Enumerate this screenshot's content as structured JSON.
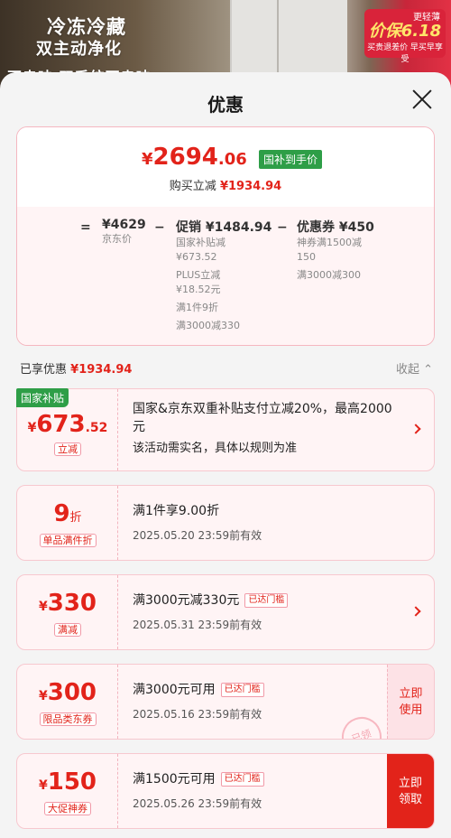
{
  "background": {
    "line1": "冷冻冷藏",
    "line2": "双主动净化",
    "line3": "不串味 双系统不串味",
    "promo_top": "更轻薄",
    "promo_main": "价保6.18",
    "promo_sub": "买贵退差价 早买早享受"
  },
  "sheet": {
    "title": "优惠"
  },
  "summary": {
    "price_yen": "¥",
    "price_int": "2694",
    "price_dec": ".06",
    "price_tag": "国补到手价",
    "save_label": "购买立减",
    "save_amount": "¥1934.94",
    "equals": "=",
    "jd_price": "¥4629",
    "jd_price_label": "京东价",
    "minus": "−",
    "promo_title": "促销",
    "promo_amount": "¥1484.94",
    "promo_lines": [
      "国家补贴减",
      "¥673.52",
      "PLUS立减",
      "¥18.52元",
      "满1件9折",
      "满3000减330"
    ],
    "coupon_title": "优惠券",
    "coupon_amount": "¥450",
    "coupon_lines": [
      "神券满1500减",
      "150",
      "满3000减300"
    ]
  },
  "enjoyed": {
    "label": "已享优惠",
    "amount": "¥1934.94",
    "collapse": "收起"
  },
  "coupons": [
    {
      "badge": "国家补贴",
      "yen": "¥",
      "amount": "673",
      "dec": ".52",
      "tag": "立减",
      "desc": "国家&京东双重补贴支付立减20%，最高2000元",
      "desc2": "该活动需实名，具体以规则为准"
    },
    {
      "amount": "9",
      "unit": "折",
      "tag": "单品满件折",
      "desc": "满1件享9.00折",
      "date": "2025.05.20  23:59前有效"
    },
    {
      "yen": "¥",
      "amount": "330",
      "tag": "满减",
      "desc": "满3000元减330元",
      "met": "已达门槛",
      "date": "2025.05.31  23:59前有效"
    },
    {
      "yen": "¥",
      "amount": "300",
      "tag": "限品类东券",
      "desc": "满3000元可用",
      "met": "已达门槛",
      "date": "2025.05.16  23:59前有效",
      "btn1": "立即",
      "btn2": "使用",
      "stamp": "已领"
    },
    {
      "yen": "¥",
      "amount": "150",
      "tag": "大促神券",
      "desc": "满1500元可用",
      "met": "已达门槛",
      "date": "2025.05.26  23:59前有效",
      "btn1": "立即",
      "btn2": "领取"
    }
  ],
  "colors": {
    "accent": "#e2231a",
    "gov_green": "#2e9e47",
    "card_bg": "#fff4f5"
  }
}
